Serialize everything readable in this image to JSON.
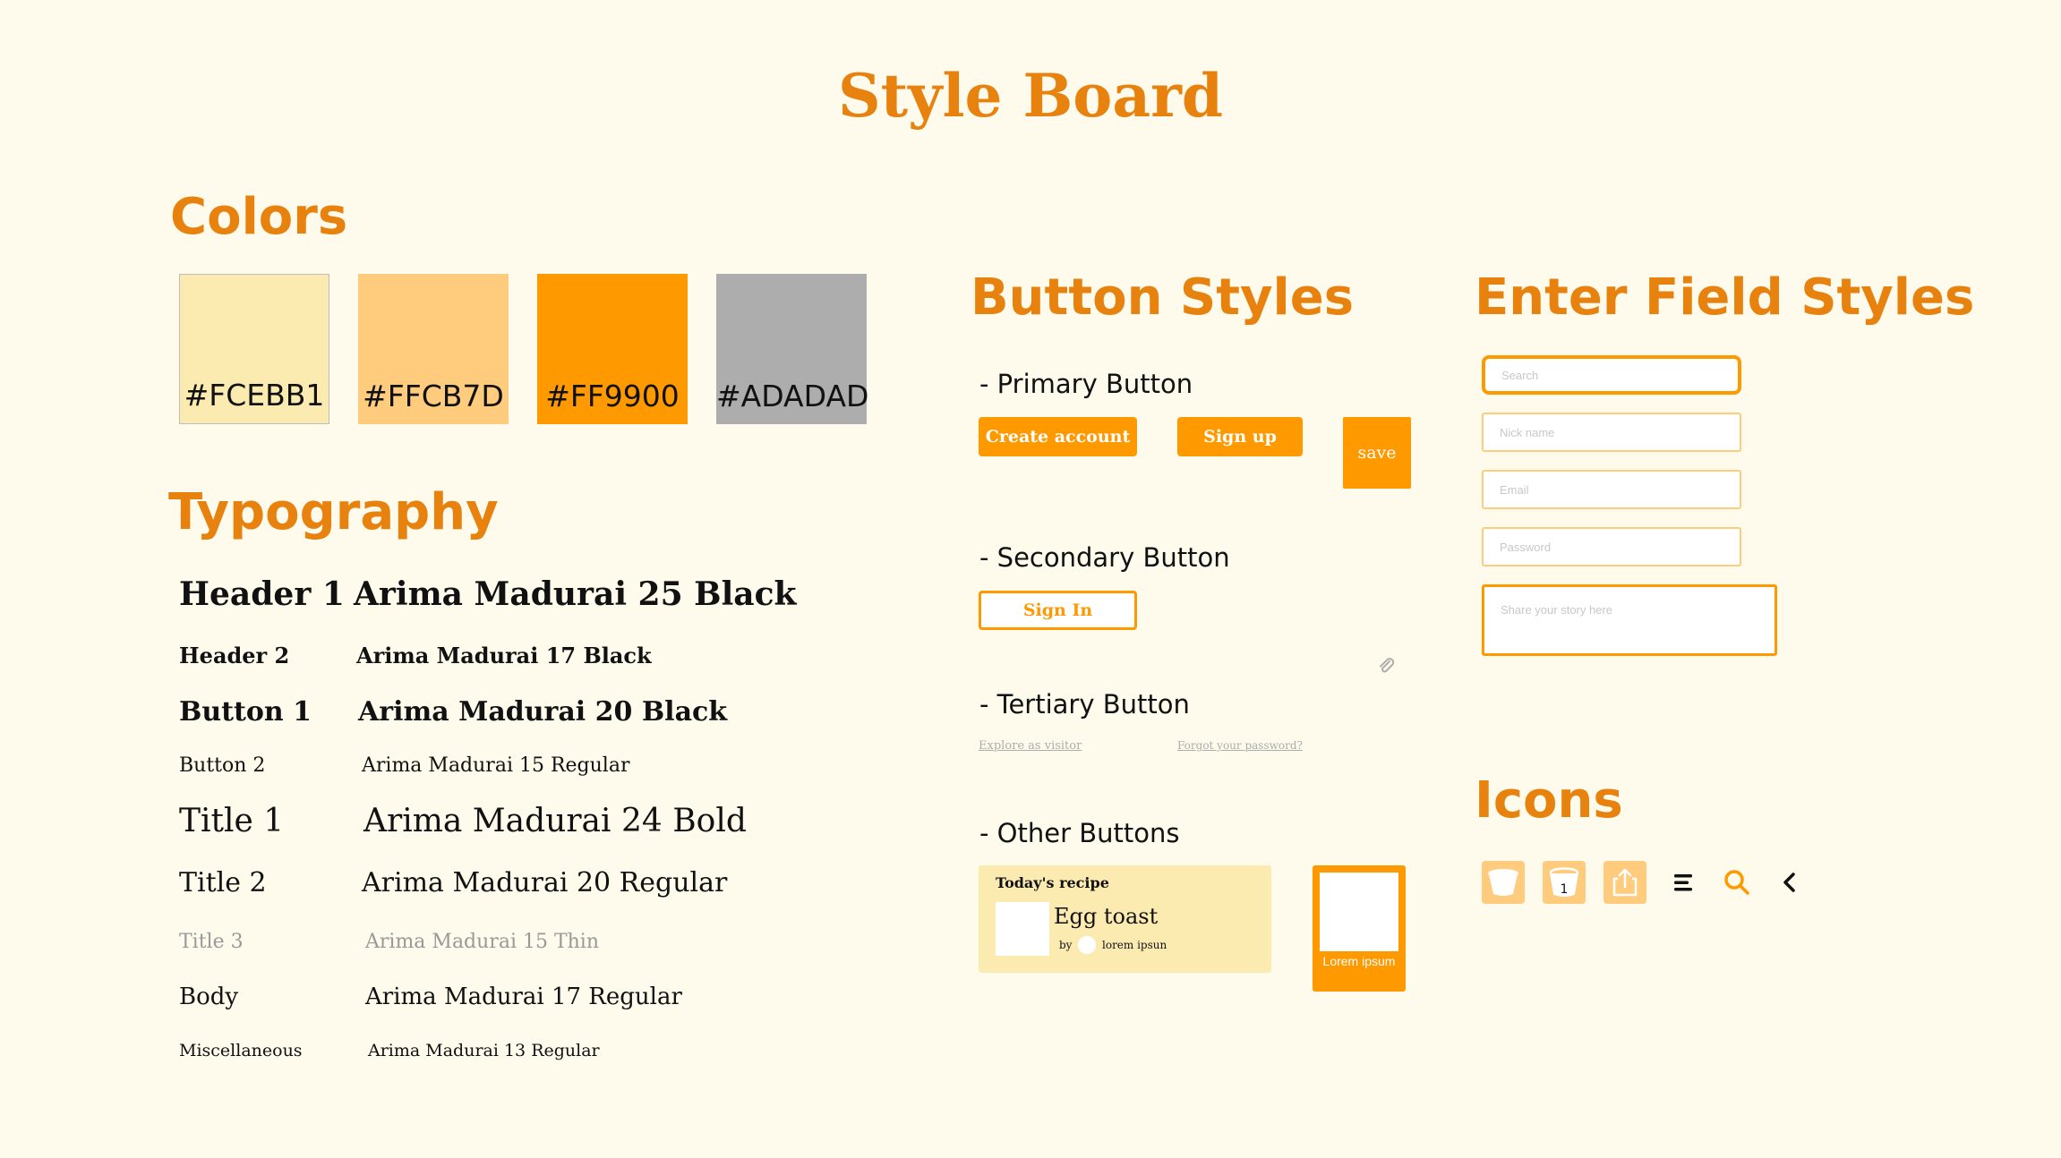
{
  "title": "Style Board",
  "colors": {
    "heading": "Colors",
    "swatches": [
      {
        "label": "#FCEBB1",
        "hex": "#FCEBB1"
      },
      {
        "label": "#FFCB7D",
        "hex": "#FFCB7D"
      },
      {
        "label": "#FF9900",
        "hex": "#FF9900"
      },
      {
        "label": "#ADADAD",
        "hex": "#ADADAD"
      }
    ]
  },
  "typography": {
    "heading": "Typography",
    "rows": [
      {
        "name": "Header 1",
        "spec": "Arima Madurai 25 Black"
      },
      {
        "name": "Header 2",
        "spec": "Arima Madurai 17 Black"
      },
      {
        "name": "Button 1",
        "spec": "Arima Madurai 20 Black"
      },
      {
        "name": "Button 2",
        "spec": "Arima Madurai 15 Regular"
      },
      {
        "name": "Title 1",
        "spec": "Arima Madurai 24 Bold"
      },
      {
        "name": "Title 2",
        "spec": "Arima Madurai 20 Regular"
      },
      {
        "name": "Title 3",
        "spec": "Arima Madurai 15 Thin"
      },
      {
        "name": "Body",
        "spec": "Arima Madurai 17 Regular"
      },
      {
        "name": "Miscellaneous",
        "spec": "Arima Madurai 13 Regular"
      }
    ]
  },
  "buttons": {
    "heading": "Button Styles",
    "primary": {
      "heading": "- Primary Button",
      "create_account": "Create account",
      "sign_up": "Sign up",
      "save": "save"
    },
    "secondary": {
      "heading": "- Secondary Button",
      "sign_in": "Sign In"
    },
    "tertiary": {
      "heading": "- Tertiary Button",
      "explore": "Explore as visitor",
      "forgot": "Forgot your password?"
    },
    "other": {
      "heading": "- Other Buttons",
      "card_label": "Today's recipe",
      "card_title": "Egg toast",
      "card_by": "by",
      "card_author": "lorem ipsun",
      "tile_label": "Lorem ipsum"
    }
  },
  "fields": {
    "heading": "Enter Field Styles",
    "search": "Search",
    "nickname": "Nick name",
    "email": "Email",
    "password": "Password",
    "story": "Share your story  here"
  },
  "icons": {
    "heading": "Icons",
    "items": [
      "cup-icon",
      "cup-count-icon",
      "share-icon",
      "menu-icon",
      "search-icon",
      "back-chevron-icon"
    ],
    "cup_count": "1"
  },
  "palette": {
    "accent": "#E8820E",
    "primary": "#FF9900",
    "light": "#FCEBB1",
    "mid": "#FFCB7D",
    "gray": "#ADADAD",
    "background": "#FEFAEC"
  }
}
